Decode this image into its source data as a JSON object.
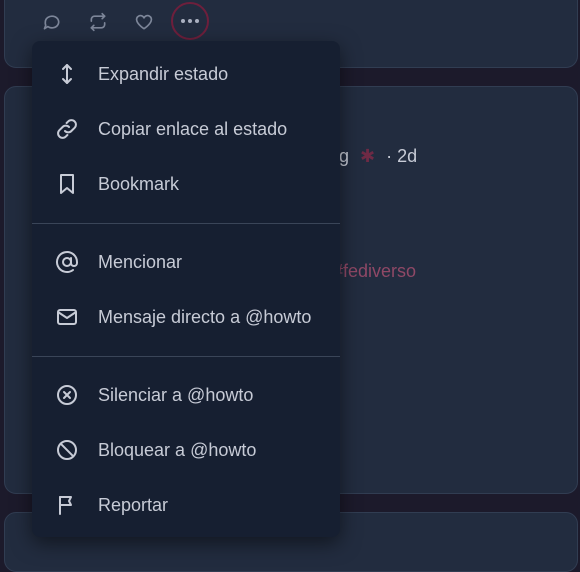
{
  "post": {
    "meta_domain": "t.org",
    "meta_time": "· 2d",
    "hashtags": "to #fediverso"
  },
  "menu": {
    "items": [
      {
        "id": "expand",
        "label": "Expandir estado",
        "icon": "expand-vertical-icon"
      },
      {
        "id": "copy-link",
        "label": "Copiar enlace al estado",
        "icon": "link-icon"
      },
      {
        "id": "bookmark",
        "label": "Bookmark",
        "icon": "bookmark-icon"
      },
      {
        "id": "mention",
        "label": "Mencionar",
        "icon": "at-sign-icon"
      },
      {
        "id": "direct-message",
        "label": "Mensaje directo a @howto",
        "icon": "mail-icon"
      },
      {
        "id": "mute",
        "label": "Silenciar a @howto",
        "icon": "mute-circle-icon"
      },
      {
        "id": "block",
        "label": "Bloquear a @howto",
        "icon": "block-icon"
      },
      {
        "id": "report",
        "label": "Reportar",
        "icon": "flag-icon"
      }
    ]
  }
}
